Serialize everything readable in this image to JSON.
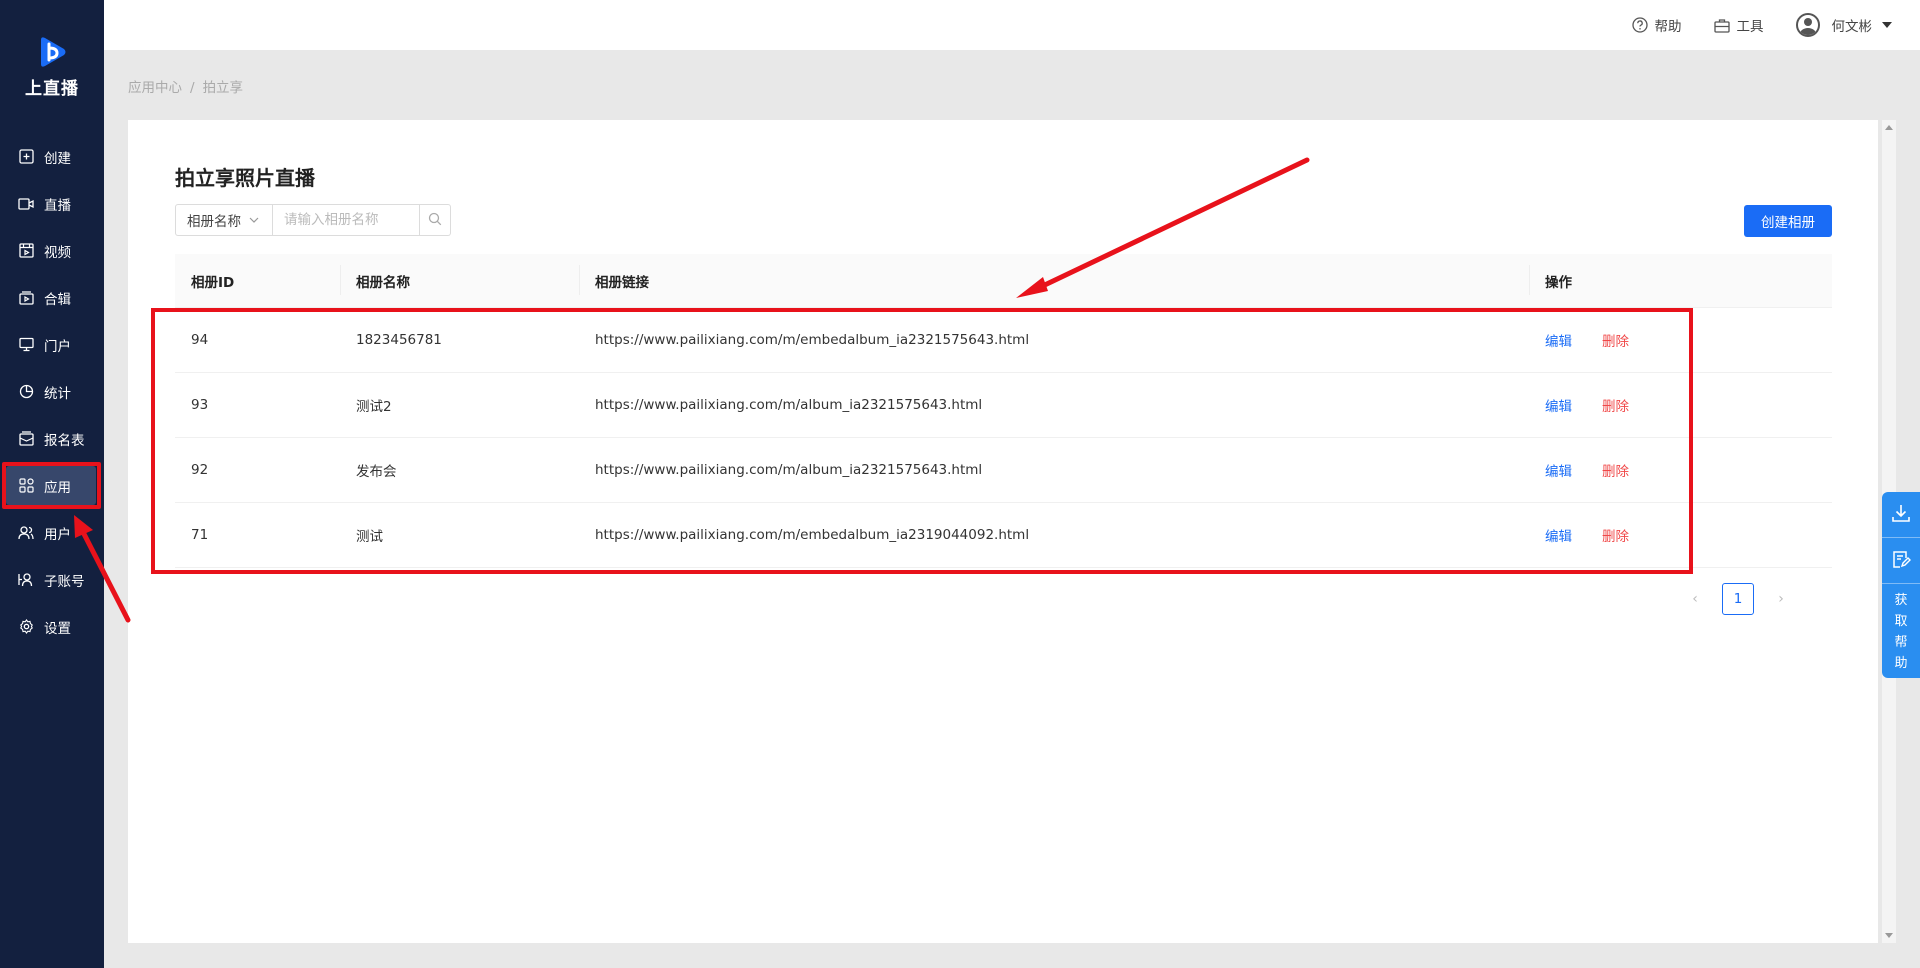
{
  "app": {
    "name": "上直播"
  },
  "sidebar": {
    "items": [
      {
        "label": "创建",
        "icon": "plus-square-icon"
      },
      {
        "label": "直播",
        "icon": "video-camera-icon"
      },
      {
        "label": "视频",
        "icon": "film-icon"
      },
      {
        "label": "合辑",
        "icon": "collection-icon"
      },
      {
        "label": "门户",
        "icon": "monitor-icon"
      },
      {
        "label": "统计",
        "icon": "pie-chart-icon"
      },
      {
        "label": "报名表",
        "icon": "form-icon"
      },
      {
        "label": "应用",
        "icon": "apps-grid-icon",
        "active": true
      },
      {
        "label": "用户",
        "icon": "users-icon"
      },
      {
        "label": "子账号",
        "icon": "sub-account-icon"
      },
      {
        "label": "设置",
        "icon": "gear-icon"
      }
    ]
  },
  "header": {
    "help_label": "帮助",
    "tools_label": "工具",
    "user_name": "何文彬"
  },
  "breadcrumb": {
    "items": [
      "应用中心",
      "拍立享"
    ],
    "separator": "/"
  },
  "main": {
    "title": "拍立享照片直播",
    "filter": {
      "field_label": "相册名称",
      "placeholder": "请输入相册名称",
      "value": ""
    },
    "create_label": "创建相册",
    "table": {
      "columns": [
        "相册ID",
        "相册名称",
        "相册链接",
        "操作"
      ],
      "rows": [
        {
          "id": "94",
          "name": "1823456781",
          "url": "https://www.pailixiang.com/m/embedalbum_ia2321575643.html"
        },
        {
          "id": "93",
          "name": "测试2",
          "url": "https://www.pailixiang.com/m/album_ia2321575643.html"
        },
        {
          "id": "92",
          "name": "发布会",
          "url": "https://www.pailixiang.com/m/album_ia2321575643.html"
        },
        {
          "id": "71",
          "name": "测试",
          "url": "https://www.pailixiang.com/m/embedalbum_ia2319044092.html"
        }
      ],
      "edit_label": "编辑",
      "delete_label": "删除"
    },
    "pagination": {
      "current": "1",
      "prev": "‹",
      "next": "›"
    }
  },
  "float_help": {
    "text": "获取帮助"
  },
  "colors": {
    "sidebar_bg": "#13203f",
    "primary": "#1a6cf6",
    "danger": "#f04848",
    "annotation": "#e8121b"
  }
}
